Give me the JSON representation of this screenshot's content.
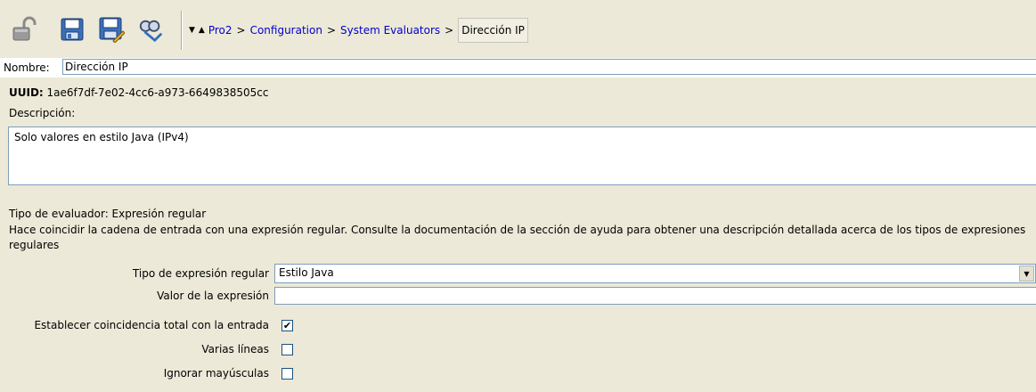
{
  "toolbar": {
    "icons": [
      "unlock-icon",
      "save-icon",
      "save-as-icon",
      "find-usages-icon"
    ]
  },
  "breadcrumb": {
    "down_arrow": "▼",
    "up_arrow": "▲",
    "items": [
      "Pro2",
      "Configuration",
      "System Evaluators"
    ],
    "separator": ">",
    "current": "Dirección IP"
  },
  "nombre": {
    "label": "Nombre:",
    "value": "Dirección IP"
  },
  "uuid": {
    "label": "UUID:",
    "value": "1ae6f7df-7e02-4cc6-a973-6649838505cc"
  },
  "descripcion": {
    "label": "Descripción:",
    "value": "Solo valores en estilo Java (IPv4)"
  },
  "evaluator": {
    "type_line": "Tipo de evaluador: Expresión regular",
    "help": "Hace coincidir la cadena de entrada con una expresión regular. Consulte la documentación de la sección de ayuda para obtener una descripción detallada acerca de los tipos de expresiones regulares"
  },
  "form": {
    "regex_type_label": "Tipo de expresión regular",
    "regex_type_value": "Estilo Java",
    "expression_label": "Valor de la expresión",
    "expression_value": "",
    "full_match_label": "Establecer coincidencia total con la entrada",
    "full_match_checked": true,
    "multiline_label": "Varias líneas",
    "multiline_checked": false,
    "ignore_case_label": "Ignorar mayúsculas",
    "ignore_case_checked": false
  }
}
